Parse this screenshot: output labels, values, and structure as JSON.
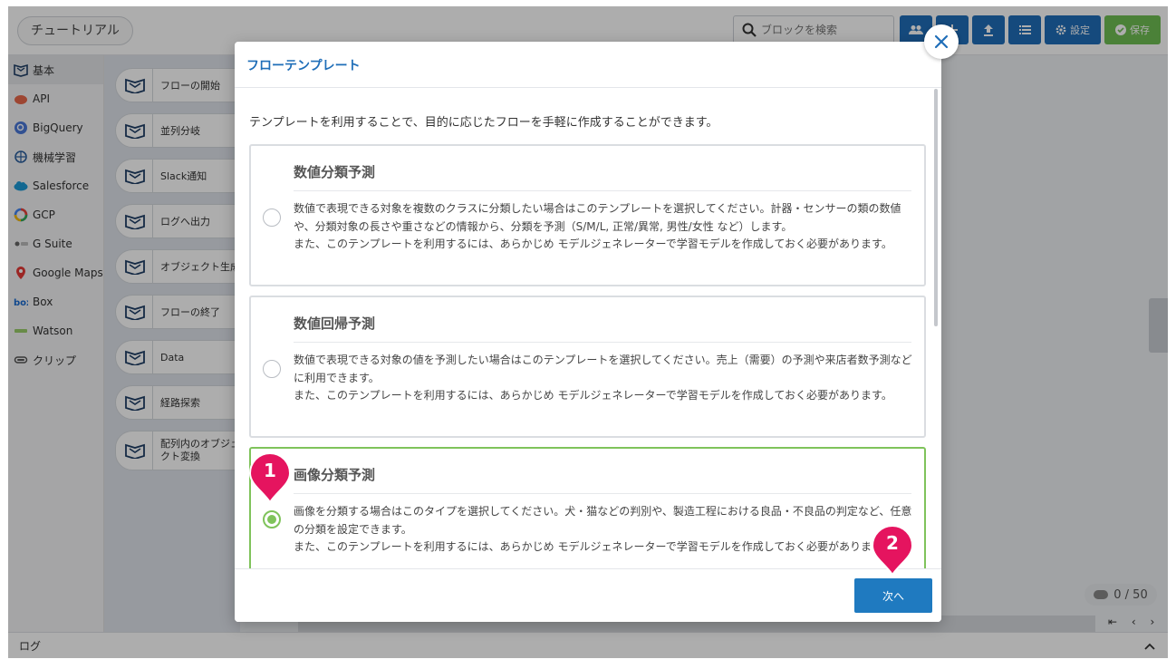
{
  "app": {
    "title": "チュートリアル",
    "search": {
      "placeholder": "ブロックを検索"
    },
    "toolbar": {
      "settings_label": "設定",
      "save_label": "保存"
    }
  },
  "sidebar": {
    "items": [
      {
        "label": "基本",
        "icon": "basic-block-icon"
      },
      {
        "label": "API",
        "icon": "api-icon"
      },
      {
        "label": "BigQuery",
        "icon": "bigquery-icon"
      },
      {
        "label": "機械学習",
        "icon": "brain-icon"
      },
      {
        "label": "Salesforce",
        "icon": "salesforce-icon"
      },
      {
        "label": "GCP",
        "icon": "gcp-icon"
      },
      {
        "label": "G Suite",
        "icon": "gsuite-icon"
      },
      {
        "label": "Google Maps",
        "icon": "map-pin-icon"
      },
      {
        "label": "Box",
        "icon": "box-icon"
      },
      {
        "label": "Watson",
        "icon": "watson-icon"
      },
      {
        "label": "クリップ",
        "icon": "clip-icon"
      }
    ]
  },
  "blocks": {
    "items": [
      {
        "label": "フローの開始"
      },
      {
        "label": "並列分岐"
      },
      {
        "label": "Slack通知"
      },
      {
        "label": "ログへ出力"
      },
      {
        "label": "オブジェクト生成"
      },
      {
        "label": "フローの終了"
      },
      {
        "label": "Data"
      },
      {
        "label": "経路探索"
      },
      {
        "label": "配列内のオブジェクト変換"
      }
    ]
  },
  "canvas": {
    "counter": "0 / 50",
    "pager": "⇤ ‹ › ⇥"
  },
  "logbar": {
    "label": "ログ"
  },
  "modal": {
    "title": "フローテンプレート",
    "intro": "テンプレートを利用することで、目的に応じたフローを手軽に作成することができます。",
    "templates": [
      {
        "title": "数値分類予測",
        "description": [
          "数値で表現できる対象を複数のクラスに分類したい場合はこのテンプレートを選択してください。計器・センサーの類の数値や、分類対象の長さや重さなどの情報から、分類を予測（S/M/L, 正常/異常, 男性/女性 など）します。",
          "また、このテンプレートを利用するには、あらかじめ モデルジェネレーターで学習モデルを作成しておく必要があります。"
        ],
        "selected": false
      },
      {
        "title": "数値回帰予測",
        "description": [
          "数値で表現できる対象の値を予測したい場合はこのテンプレートを選択してください。売上（需要）の予測や来店者数予測などに利用できます。",
          "また、このテンプレートを利用するには、あらかじめ モデルジェネレーターで学習モデルを作成しておく必要があります。"
        ],
        "selected": false
      },
      {
        "title": "画像分類予測",
        "description": [
          "画像を分類する場合はこのタイプを選択してください。犬・猫などの判別や、製造工程における良品・不良品の判定など、任意の分類を設定できます。",
          "また、このテンプレートを利用するには、あらかじめ モデルジェネレーターで学習モデルを作成しておく必要があります。"
        ],
        "selected": true
      }
    ],
    "next_label": "次へ"
  },
  "annotations": {
    "step1": "1",
    "step2": "2"
  },
  "colors": {
    "primary": "#1f6eb8",
    "selected": "#7fc35b",
    "marker": "#e5145f"
  }
}
